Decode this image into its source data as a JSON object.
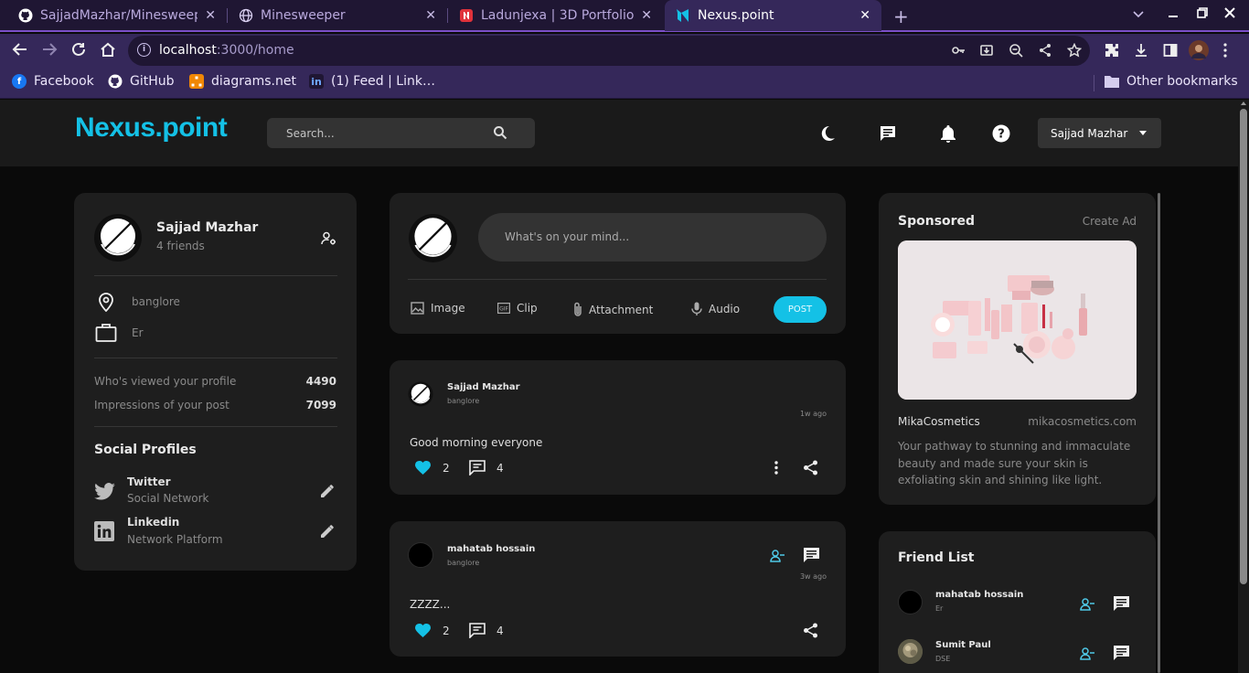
{
  "browser": {
    "tabs": [
      {
        "title": "SajjadMazhar/Minesweep"
      },
      {
        "title": "Minesweeper"
      },
      {
        "title": "Ladunjexa | 3D Portfolio"
      },
      {
        "title": "Nexus.point"
      }
    ],
    "url_host": "localhost",
    "url_path": ":3000/home",
    "bookmarks": [
      "Facebook",
      "GitHub",
      "diagrams.net",
      "(1) Feed | Link…"
    ],
    "other_bookmarks": "Other bookmarks"
  },
  "navbar": {
    "logo": "Nexus.point",
    "search_placeholder": "Search...",
    "user_name": "Sajjad Mazhar"
  },
  "profile": {
    "name": "Sajjad Mazhar",
    "friends": "4 friends",
    "location": "banglore",
    "occupation": "Er",
    "viewed_label": "Who's viewed your profile",
    "viewed_value": "4490",
    "impressions_label": "Impressions of your post",
    "impressions_value": "7099",
    "social_title": "Social Profiles",
    "social": [
      {
        "name": "Twitter",
        "type": "Social Network"
      },
      {
        "name": "Linkedin",
        "type": "Network Platform"
      }
    ]
  },
  "composer": {
    "placeholder": "What's on your mind...",
    "actions": [
      "Image",
      "Clip",
      "Attachment",
      "Audio"
    ],
    "post_label": "POST"
  },
  "posts": [
    {
      "author": "Sajjad Mazhar",
      "location": "banglore",
      "time": "1w ago",
      "text": "Good morning everyone",
      "likes": "2",
      "comments": "4"
    },
    {
      "author": "mahatab hossain",
      "location": "banglore",
      "time": "3w ago",
      "text": "ZZZZ...",
      "likes": "2",
      "comments": "4"
    }
  ],
  "sponsored": {
    "title": "Sponsored",
    "create_ad": "Create Ad",
    "brand": "MikaCosmetics",
    "site": "mikacosmetics.com",
    "description": "Your pathway to stunning and immaculate beauty and made sure your skin is exfoliating skin and shining like light."
  },
  "friend_list": {
    "title": "Friend List",
    "friends": [
      {
        "name": "mahatab hossain",
        "sub": "Er"
      },
      {
        "name": "Sumit Paul",
        "sub": "DSE"
      }
    ]
  },
  "colors": {
    "accent": "#14c1e6",
    "card": "#1e1e1e",
    "background": "#0a0a0a"
  }
}
